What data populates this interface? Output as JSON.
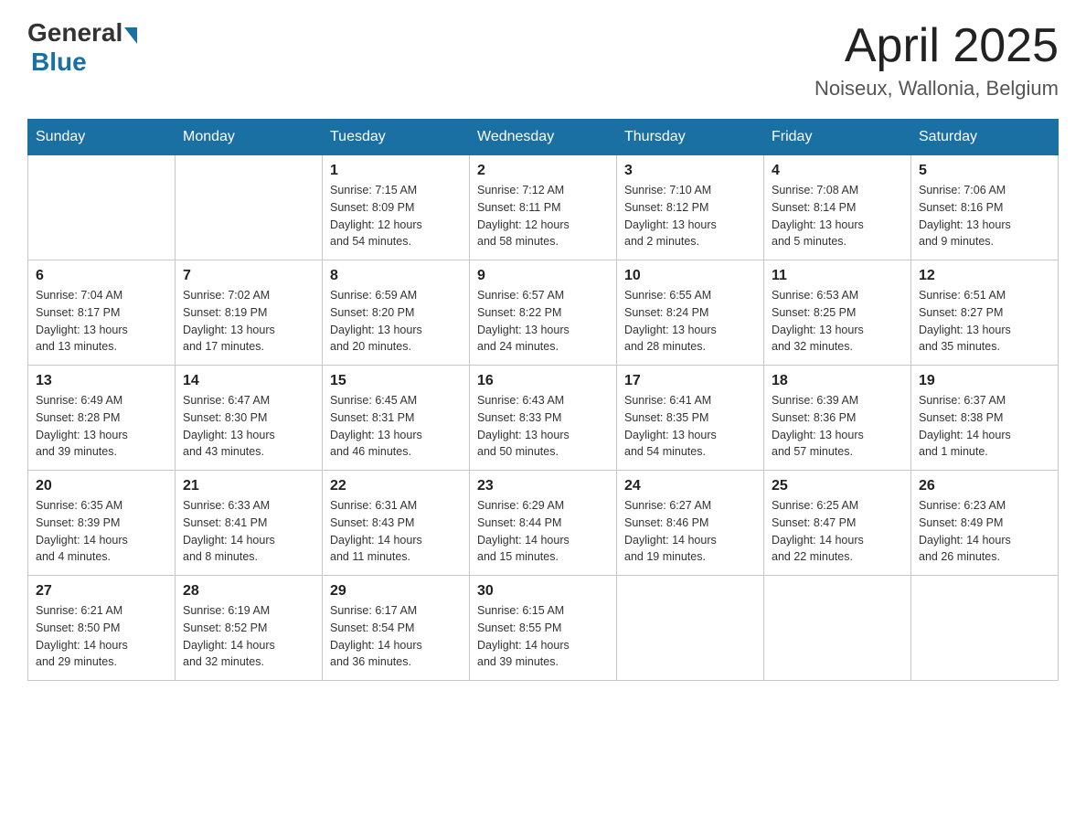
{
  "logo": {
    "general": "General",
    "blue": "Blue"
  },
  "title": {
    "month": "April 2025",
    "location": "Noiseux, Wallonia, Belgium"
  },
  "days_of_week": [
    "Sunday",
    "Monday",
    "Tuesday",
    "Wednesday",
    "Thursday",
    "Friday",
    "Saturday"
  ],
  "weeks": [
    [
      {
        "day": "",
        "info": ""
      },
      {
        "day": "",
        "info": ""
      },
      {
        "day": "1",
        "info": "Sunrise: 7:15 AM\nSunset: 8:09 PM\nDaylight: 12 hours\nand 54 minutes."
      },
      {
        "day": "2",
        "info": "Sunrise: 7:12 AM\nSunset: 8:11 PM\nDaylight: 12 hours\nand 58 minutes."
      },
      {
        "day": "3",
        "info": "Sunrise: 7:10 AM\nSunset: 8:12 PM\nDaylight: 13 hours\nand 2 minutes."
      },
      {
        "day": "4",
        "info": "Sunrise: 7:08 AM\nSunset: 8:14 PM\nDaylight: 13 hours\nand 5 minutes."
      },
      {
        "day": "5",
        "info": "Sunrise: 7:06 AM\nSunset: 8:16 PM\nDaylight: 13 hours\nand 9 minutes."
      }
    ],
    [
      {
        "day": "6",
        "info": "Sunrise: 7:04 AM\nSunset: 8:17 PM\nDaylight: 13 hours\nand 13 minutes."
      },
      {
        "day": "7",
        "info": "Sunrise: 7:02 AM\nSunset: 8:19 PM\nDaylight: 13 hours\nand 17 minutes."
      },
      {
        "day": "8",
        "info": "Sunrise: 6:59 AM\nSunset: 8:20 PM\nDaylight: 13 hours\nand 20 minutes."
      },
      {
        "day": "9",
        "info": "Sunrise: 6:57 AM\nSunset: 8:22 PM\nDaylight: 13 hours\nand 24 minutes."
      },
      {
        "day": "10",
        "info": "Sunrise: 6:55 AM\nSunset: 8:24 PM\nDaylight: 13 hours\nand 28 minutes."
      },
      {
        "day": "11",
        "info": "Sunrise: 6:53 AM\nSunset: 8:25 PM\nDaylight: 13 hours\nand 32 minutes."
      },
      {
        "day": "12",
        "info": "Sunrise: 6:51 AM\nSunset: 8:27 PM\nDaylight: 13 hours\nand 35 minutes."
      }
    ],
    [
      {
        "day": "13",
        "info": "Sunrise: 6:49 AM\nSunset: 8:28 PM\nDaylight: 13 hours\nand 39 minutes."
      },
      {
        "day": "14",
        "info": "Sunrise: 6:47 AM\nSunset: 8:30 PM\nDaylight: 13 hours\nand 43 minutes."
      },
      {
        "day": "15",
        "info": "Sunrise: 6:45 AM\nSunset: 8:31 PM\nDaylight: 13 hours\nand 46 minutes."
      },
      {
        "day": "16",
        "info": "Sunrise: 6:43 AM\nSunset: 8:33 PM\nDaylight: 13 hours\nand 50 minutes."
      },
      {
        "day": "17",
        "info": "Sunrise: 6:41 AM\nSunset: 8:35 PM\nDaylight: 13 hours\nand 54 minutes."
      },
      {
        "day": "18",
        "info": "Sunrise: 6:39 AM\nSunset: 8:36 PM\nDaylight: 13 hours\nand 57 minutes."
      },
      {
        "day": "19",
        "info": "Sunrise: 6:37 AM\nSunset: 8:38 PM\nDaylight: 14 hours\nand 1 minute."
      }
    ],
    [
      {
        "day": "20",
        "info": "Sunrise: 6:35 AM\nSunset: 8:39 PM\nDaylight: 14 hours\nand 4 minutes."
      },
      {
        "day": "21",
        "info": "Sunrise: 6:33 AM\nSunset: 8:41 PM\nDaylight: 14 hours\nand 8 minutes."
      },
      {
        "day": "22",
        "info": "Sunrise: 6:31 AM\nSunset: 8:43 PM\nDaylight: 14 hours\nand 11 minutes."
      },
      {
        "day": "23",
        "info": "Sunrise: 6:29 AM\nSunset: 8:44 PM\nDaylight: 14 hours\nand 15 minutes."
      },
      {
        "day": "24",
        "info": "Sunrise: 6:27 AM\nSunset: 8:46 PM\nDaylight: 14 hours\nand 19 minutes."
      },
      {
        "day": "25",
        "info": "Sunrise: 6:25 AM\nSunset: 8:47 PM\nDaylight: 14 hours\nand 22 minutes."
      },
      {
        "day": "26",
        "info": "Sunrise: 6:23 AM\nSunset: 8:49 PM\nDaylight: 14 hours\nand 26 minutes."
      }
    ],
    [
      {
        "day": "27",
        "info": "Sunrise: 6:21 AM\nSunset: 8:50 PM\nDaylight: 14 hours\nand 29 minutes."
      },
      {
        "day": "28",
        "info": "Sunrise: 6:19 AM\nSunset: 8:52 PM\nDaylight: 14 hours\nand 32 minutes."
      },
      {
        "day": "29",
        "info": "Sunrise: 6:17 AM\nSunset: 8:54 PM\nDaylight: 14 hours\nand 36 minutes."
      },
      {
        "day": "30",
        "info": "Sunrise: 6:15 AM\nSunset: 8:55 PM\nDaylight: 14 hours\nand 39 minutes."
      },
      {
        "day": "",
        "info": ""
      },
      {
        "day": "",
        "info": ""
      },
      {
        "day": "",
        "info": ""
      }
    ]
  ]
}
